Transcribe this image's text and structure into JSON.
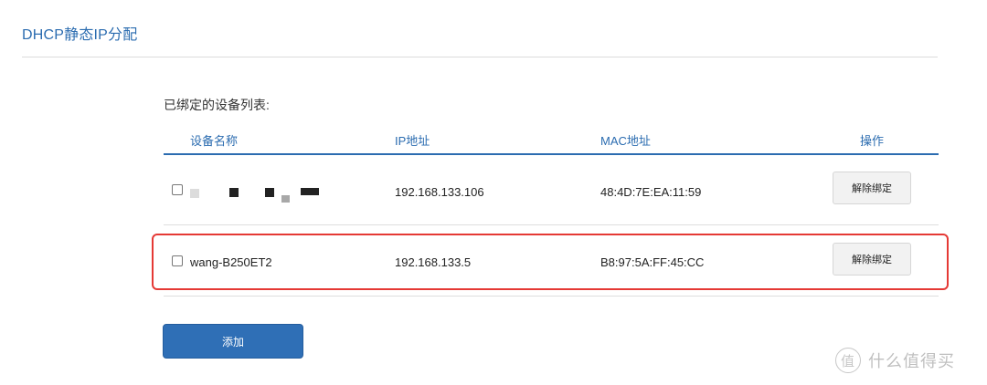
{
  "page_title": "DHCP静态IP分配",
  "section_label": "已绑定的设备列表:",
  "table": {
    "headers": [
      "设备名称",
      "IP地址",
      "MAC地址",
      "操作"
    ],
    "rows": [
      {
        "name": "",
        "ip": "192.168.133.106",
        "mac": "48:4D:7E:EA:11:59",
        "action": "解除绑定"
      },
      {
        "name": "wang-B250ET2",
        "ip": "192.168.133.5",
        "mac": "B8:97:5A:FF:45:CC",
        "action": "解除绑定"
      }
    ]
  },
  "buttons": {
    "add": "添加"
  },
  "watermark": {
    "icon": "值",
    "text": "什么值得买"
  },
  "colors": {
    "accent": "#2b6cb0",
    "highlight": "#e53935",
    "button_bg": "#2f6fb6"
  }
}
